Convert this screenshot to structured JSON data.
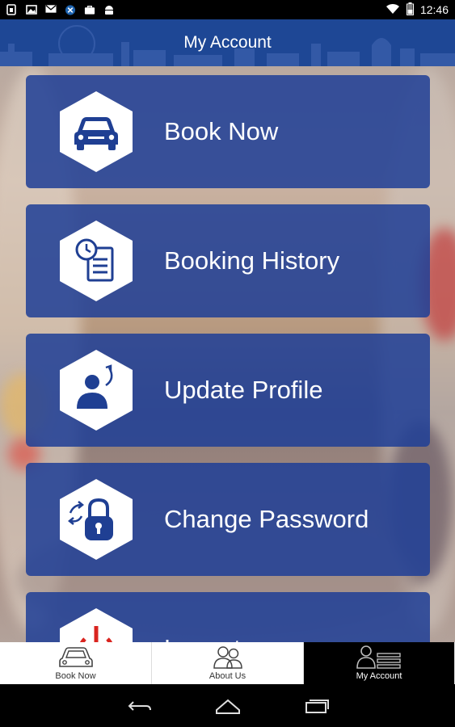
{
  "status_bar": {
    "time": "12:46",
    "icons": [
      "sim-icon",
      "image-icon",
      "mail-icon",
      "vpn-icon",
      "bag-icon",
      "android-icon"
    ],
    "right_icons": [
      "wifi-icon",
      "battery-icon"
    ]
  },
  "header": {
    "title": "My Account"
  },
  "menu": {
    "items": [
      {
        "label": "Book Now",
        "icon": "car-icon"
      },
      {
        "label": "Booking History",
        "icon": "history-document-icon"
      },
      {
        "label": "Update Profile",
        "icon": "profile-update-icon"
      },
      {
        "label": "Change Password",
        "icon": "padlock-refresh-icon"
      },
      {
        "label": "Logout",
        "icon": "power-icon"
      }
    ]
  },
  "tabbar": {
    "tabs": [
      {
        "label": "Book Now",
        "icon": "car-icon",
        "active": false
      },
      {
        "label": "About Us",
        "icon": "people-icon",
        "active": false
      },
      {
        "label": "My Account",
        "icon": "account-list-icon",
        "active": true
      }
    ]
  },
  "colors": {
    "header_blue": "#1e4795",
    "tile_blue": "#203f96",
    "icon_blue": "#1f3f93",
    "logout_red": "#d9241f"
  },
  "navbar": {
    "icons": [
      "back-icon",
      "home-icon",
      "recents-icon"
    ]
  }
}
